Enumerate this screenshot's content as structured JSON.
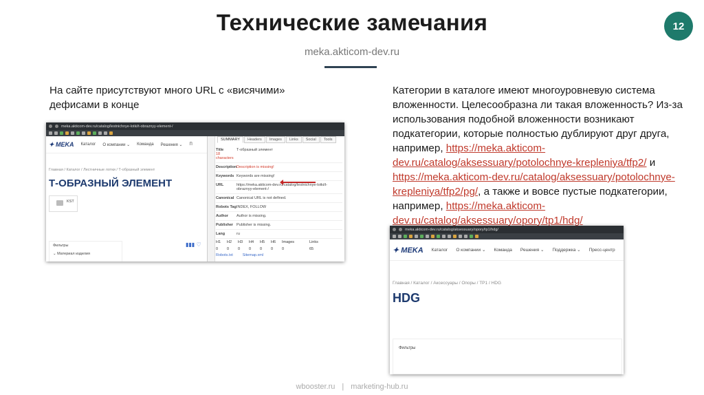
{
  "slide": {
    "title": "Технические замечания",
    "number": "12",
    "subtitle": "meka.akticom-dev.ru"
  },
  "left_text": "На сайте присутствуют много URL с «висячими» дефисами в конце",
  "right_text": {
    "p1": "Категории в каталоге имеют многоуровневую система вложенности. Целесообразна ли такая вложенность? Из-за использования подобной вложенности возникают подкатегории, которые полностью дублируют друг друга, например, ",
    "link1": "https://meka.akticom-dev.ru/catalog/aksessuary/potolochnye-krepleniya/tfp2/",
    "p2": " и ",
    "link2": "https://meka.akticom-dev.ru/catalog/aksessuary/potolochnye-krepleniya/tfp2/pg/",
    "p3": ", а также и вовсе пустые подкатегории, например, ",
    "link3": "https://meka.akticom-dev.ru/catalog/aksessuary/opory/tp1/hdg/"
  },
  "footer": {
    "left": "wbooster.ru",
    "sep": "|",
    "right": "marketing-hub.ru"
  },
  "shot1": {
    "url": "meka.akticom-dev.ru/catalog/lestnichnye-lotki/t-obraznyy-element-/",
    "logo": "MEKA",
    "nav": [
      "Каталог",
      "О компании",
      "Команда",
      "Решения",
      "П"
    ],
    "breadcrumb": "Главная / Каталог / Лестничные лотки / Т-образный элемент",
    "heading": "Т-ОБРАЗНЫЙ ЭЛЕМЕНТ",
    "kst": "KST",
    "filters": "Фильтры",
    "filter_item": "Материал изделия",
    "tabs": [
      "SUMMARY",
      "Headers",
      "Images",
      "Links",
      "Social",
      "Tools"
    ],
    "rows": [
      {
        "k": "Title",
        "sub": "18 characters",
        "v": "Т-образный элемент",
        "red": false
      },
      {
        "k": "Description",
        "sub": "",
        "v": "Description is missing!",
        "red": true
      },
      {
        "k": "Keywords",
        "sub": "",
        "v": "Keywords are missing!",
        "red": false
      },
      {
        "k": "URL",
        "sub": "",
        "v": "https://meka.akticom-dev.ru/catalog/lestnichnye-lotki/t-obraznyy-element-/",
        "red": false
      },
      {
        "k": "Canonical",
        "sub": "",
        "v": "Canonical URL is not defined.",
        "red": false
      },
      {
        "k": "Robots Tag",
        "sub": "",
        "v": "INDEX, FOLLOW",
        "red": false
      },
      {
        "k": "Author",
        "sub": "",
        "v": "Author is missing.",
        "red": false
      },
      {
        "k": "Publisher",
        "sub": "",
        "v": "Publisher is missing.",
        "red": false
      },
      {
        "k": "Lang",
        "sub": "",
        "v": "ru",
        "red": false
      }
    ],
    "headings_row": [
      "H1",
      "H2",
      "H3",
      "H4",
      "H5",
      "H6",
      "Images",
      "Links"
    ],
    "headings_values": [
      "0",
      "0",
      "0",
      "0",
      "0",
      "0",
      "0",
      "65"
    ],
    "footer_links": [
      "Robots.txt",
      "Sitemap.xml"
    ]
  },
  "shot2": {
    "url": "meka.akticom-dev.ru/catalog/aksessuary/opory/tp1/hdg/",
    "logo": "MEKA",
    "nav": [
      "Каталог",
      "О компании",
      "Команда",
      "Решения",
      "Поддержка",
      "Пресс-центр"
    ],
    "breadcrumb": "Главная / Каталог / Аксессуары / Опоры / TP1 / HDG",
    "heading": "HDG",
    "filters": "Фильтры"
  }
}
